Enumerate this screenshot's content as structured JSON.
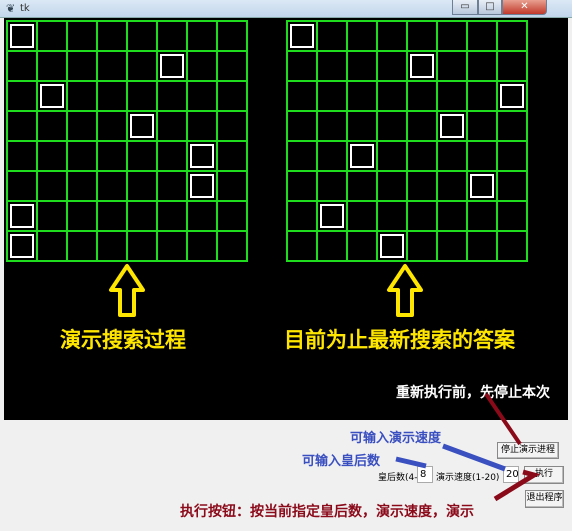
{
  "window": {
    "title": "tk",
    "icon": "feather-icon",
    "min": "▭",
    "max": "□",
    "close": "✕"
  },
  "boards": {
    "search": {
      "size": 8,
      "queens": [
        0,
        5,
        1,
        4,
        6,
        6,
        0,
        0
      ]
    },
    "answer": {
      "size": 8,
      "queens": [
        0,
        4,
        7,
        5,
        2,
        6,
        1,
        3
      ]
    }
  },
  "annotations": {
    "search_label": "演示搜索过程",
    "answer_label": "目前为止最新搜索的答案",
    "stop_note": "重新执行前，先停止本次",
    "speed_note": "可输入演示速度",
    "queens_note": "可输入皇后数",
    "run_note": "执行按钮：按当前指定皇后数，演示速度，演示"
  },
  "controls": {
    "queens_label": "皇后数(4-8)",
    "queens_value": "8",
    "speed_label": "演示速度(1-20)",
    "speed_value": "20",
    "stop_button": "停止演示进程",
    "run_button": "执行",
    "exit_button": "退出程序"
  },
  "colors": {
    "grid": "#1fdc1f",
    "arrow": "#ffe600",
    "note_blue": "#3a4fc0",
    "note_red": "#8b0a1a"
  }
}
